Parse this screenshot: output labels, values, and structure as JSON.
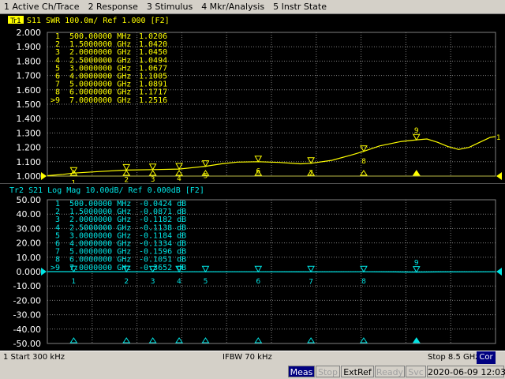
{
  "menu": [
    "1 Active Ch/Trace",
    "2 Response",
    "3 Stimulus",
    "4 Mkr/Analysis",
    "5 Instr State"
  ],
  "colors": {
    "trace1": "#ffff00",
    "trace2": "#00e5e5",
    "grid": "#808080",
    "axis_text": "#ffffff"
  },
  "trace1": {
    "badge": "Tr1",
    "header": "S11  SWR 100.0m/ Ref 1.000 [F2]",
    "yticks": [
      "2.000",
      "1.900",
      "1.800",
      "1.700",
      "1.600",
      "1.500",
      "1.400",
      "1.300",
      "1.200",
      "1.100",
      "1.000"
    ],
    "ref_label": "1",
    "markers": [
      {
        "id": "1",
        "label": "1",
        "freq": "500.00000 MHz",
        "value": "1.0206"
      },
      {
        "id": "2",
        "label": "2",
        "freq": "1.5000000 GHz",
        "value": "1.0420"
      },
      {
        "id": "3",
        "label": "3",
        "freq": "2.0000000 GHz",
        "value": "1.0450"
      },
      {
        "id": "4",
        "label": "4",
        "freq": "2.5000000 GHz",
        "value": "1.0494"
      },
      {
        "id": "5",
        "label": "5",
        "freq": "3.0000000 GHz",
        "value": "1.0677"
      },
      {
        "id": "6",
        "label": "6",
        "freq": "4.0000000 GHz",
        "value": "1.1005"
      },
      {
        "id": "7",
        "label": "7",
        "freq": "5.0000000 GHz",
        "value": "1.0891"
      },
      {
        "id": "8",
        "label": "8",
        "freq": "6.0000000 GHz",
        "value": "1.1717"
      },
      {
        "id": "9",
        "label": ">9",
        "freq": "7.0000000 GHz",
        "value": "1.2516"
      }
    ]
  },
  "trace2": {
    "header": "Tr2  S21  Log Mag 10.00dB/ Ref 0.000dB [F2]",
    "yticks": [
      "50.00",
      "40.00",
      "30.00",
      "20.00",
      "10.00",
      "0.000",
      "-10.00",
      "-20.00",
      "-30.00",
      "-40.00",
      "-50.00"
    ],
    "markers": [
      {
        "id": "1",
        "label": "1",
        "freq": "500.00000 MHz",
        "value": "-0.0424 dB"
      },
      {
        "id": "2",
        "label": "2",
        "freq": "1.5000000 GHz",
        "value": "-0.0871 dB"
      },
      {
        "id": "3",
        "label": "3",
        "freq": "2.0000000 GHz",
        "value": "-0.1182 dB"
      },
      {
        "id": "4",
        "label": "4",
        "freq": "2.5000000 GHz",
        "value": "-0.1138 dB"
      },
      {
        "id": "5",
        "label": "5",
        "freq": "3.0000000 GHz",
        "value": "-0.1184 dB"
      },
      {
        "id": "6",
        "label": "6",
        "freq": "4.0000000 GHz",
        "value": "-0.1334 dB"
      },
      {
        "id": "7",
        "label": "7",
        "freq": "5.0000000 GHz",
        "value": "-0.1596 dB"
      },
      {
        "id": "8",
        "label": "8",
        "freq": "6.0000000 GHz",
        "value": "-0.1051 dB"
      },
      {
        "id": "9",
        "label": ">9",
        "freq": "7.0000000 GHz",
        "value": "-0.3652 dB"
      }
    ]
  },
  "status": {
    "start": "1  Start 300 kHz",
    "ifbw": "IFBW 70 kHz",
    "stop": "Stop 8.5 GHz",
    "cor": "Cor"
  },
  "bottom": {
    "meas": "Meas",
    "stop": "Stop",
    "extref": "ExtRef",
    "ready": "Ready",
    "svc": "Svc",
    "datetime": "2020-06-09 12:03"
  }
}
